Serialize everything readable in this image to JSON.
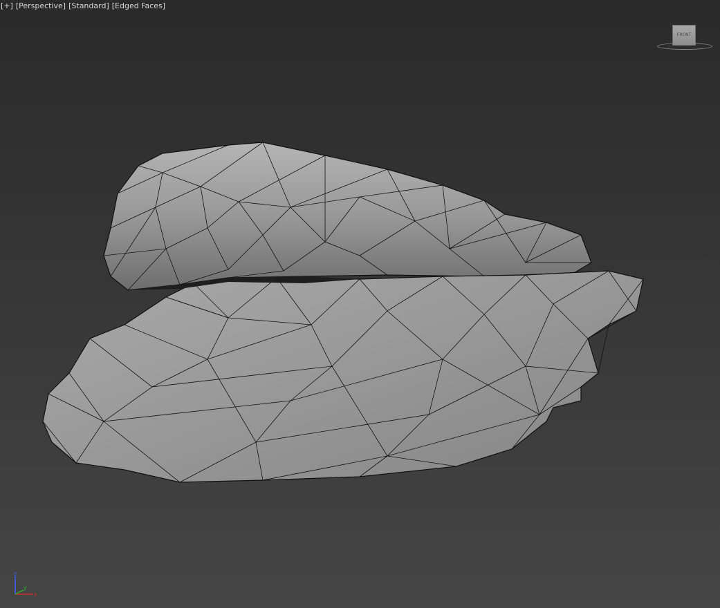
{
  "viewport": {
    "labels": {
      "plus": "[+]",
      "view": "[Perspective]",
      "shading": "[Standard]",
      "display": "[Edged Faces]"
    },
    "viewcube": {
      "face_label": "FRONT"
    },
    "axis": {
      "x_label": "x",
      "y_label": "y",
      "z_label": "z"
    }
  },
  "colors": {
    "background_top": "#2a2a2a",
    "background_bottom": "#454545",
    "mesh_fill": "#9a9a9a",
    "mesh_edge": "#101010",
    "label_text": "#d8d8d8",
    "axis_x": "#c83030",
    "axis_y": "#30b030",
    "axis_z": "#4060ff"
  }
}
